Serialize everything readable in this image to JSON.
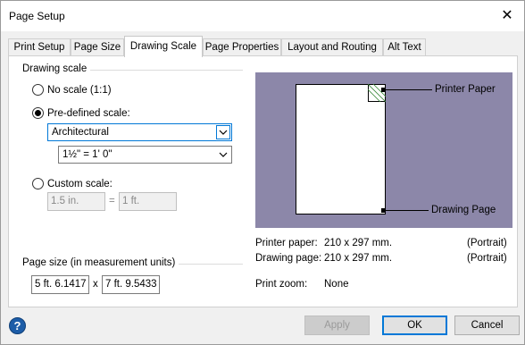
{
  "window": {
    "title": "Page Setup",
    "close_glyph": "✕"
  },
  "tabs": [
    {
      "label": "Print Setup"
    },
    {
      "label": "Page Size"
    },
    {
      "label": "Drawing Scale",
      "active": true
    },
    {
      "label": "Page Properties"
    },
    {
      "label": "Layout and Routing"
    },
    {
      "label": "Alt Text"
    }
  ],
  "drawing_scale": {
    "group_label": "Drawing scale",
    "no_scale_label": "No scale (1:1)",
    "predefined_label": "Pre-defined scale:",
    "predefined_category": "Architectural",
    "predefined_value": "1½\" = 1' 0\"",
    "custom_label": "Custom scale:",
    "custom_left": "1.5 in.",
    "custom_equals": "=",
    "custom_right": "1 ft.",
    "selected": "predefined"
  },
  "page_size": {
    "group_label": "Page size (in measurement units)",
    "width": "5 ft. 6.1417",
    "times": "x",
    "height": "7 ft. 9.5433"
  },
  "preview": {
    "printer_paper_label": "Printer Paper",
    "drawing_page_label": "Drawing Page",
    "background_color": "#8c87a9"
  },
  "info": {
    "printer_paper_key": "Printer paper:",
    "printer_paper_value": "210 x 297 mm.",
    "printer_paper_orientation": "(Portrait)",
    "drawing_page_key": "Drawing page:",
    "drawing_page_value": "210 x 297 mm.",
    "drawing_page_orientation": "(Portrait)",
    "print_zoom_key": "Print zoom:",
    "print_zoom_value": "None"
  },
  "buttons": {
    "help": "?",
    "apply": "Apply",
    "ok": "OK",
    "cancel": "Cancel"
  }
}
